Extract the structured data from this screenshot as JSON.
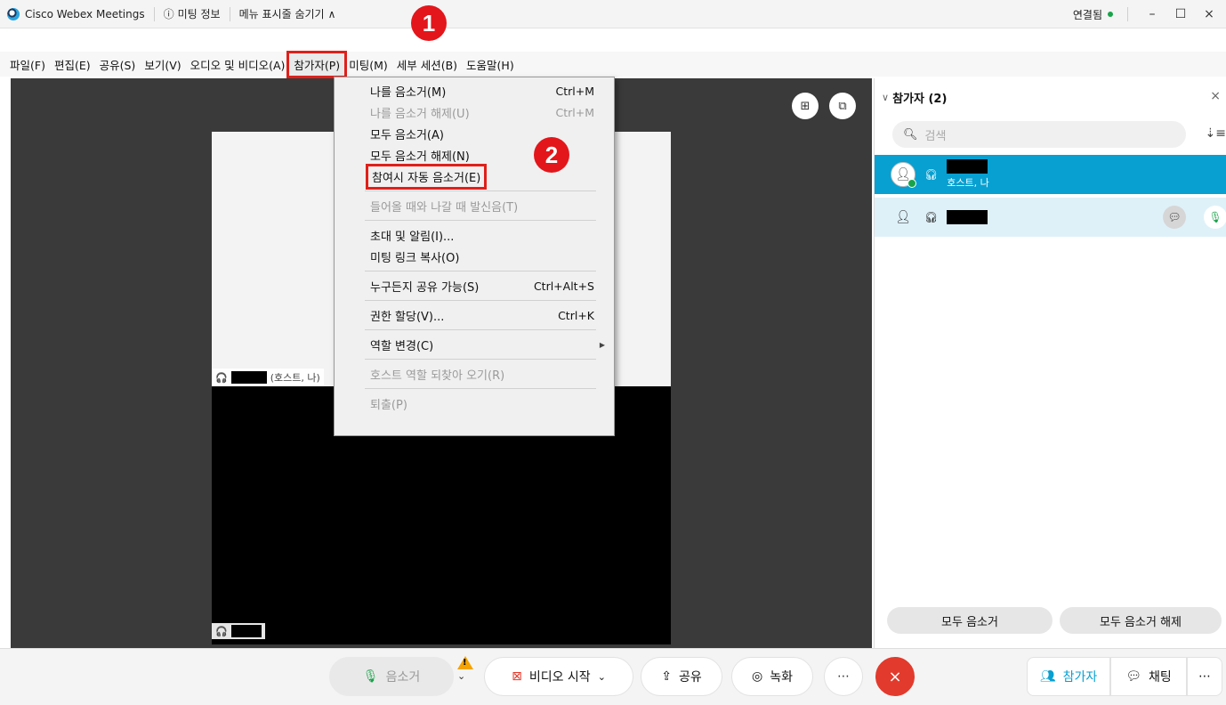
{
  "titlebar": {
    "app_name": "Cisco Webex Meetings",
    "meeting_info": "미팅 정보",
    "hide_menu": "메뉴 표시줄 숨기기",
    "status": "연결됨"
  },
  "menubar": {
    "items": [
      "파일(F)",
      "편집(E)",
      "공유(S)",
      "보기(V)",
      "오디오 및 비디오(A)",
      "참가자(P)",
      "미팅(M)",
      "세부 세션(B)",
      "도움말(H)"
    ]
  },
  "dropdown": {
    "items": [
      {
        "label": "나를 음소거(M)",
        "shortcut": "Ctrl+M"
      },
      {
        "label": "나를 음소거 해제(U)",
        "shortcut": "Ctrl+M"
      },
      {
        "label": "모두 음소거(A)"
      },
      {
        "label": "모두 음소거 해제(N)"
      },
      {
        "label": "참여시 자동 음소거(E)"
      },
      {
        "label": "들어올 때와 나갈 때 발신음(T)"
      },
      {
        "label": "초대 및 알림(I)..."
      },
      {
        "label": "미팅 링크 복사(O)"
      },
      {
        "label": "누구든지 공유 가능(S)",
        "shortcut": "Ctrl+Alt+S"
      },
      {
        "label": "권한 할당(V)...",
        "shortcut": "Ctrl+K"
      },
      {
        "label": "역할 변경(C)"
      },
      {
        "label": "호스트 역할 되찾아 오기(R)"
      },
      {
        "label": "퇴출(P)"
      }
    ]
  },
  "badges": {
    "one": "1",
    "two": "2"
  },
  "stage": {
    "host_tag": "(호스트, 나)"
  },
  "panel": {
    "title": "참가자 (2)",
    "search_placeholder": "검색",
    "host_sub": "호스트, 나",
    "mute_all": "모두 음소거",
    "unmute_all": "모두 음소거 해제"
  },
  "toolbar": {
    "mute": "음소거",
    "video": "비디오 시작",
    "share": "공유",
    "record": "녹화",
    "participants": "참가자",
    "chat": "채팅"
  },
  "colors": {
    "highlight": "#e0201a",
    "selected_row": "#07a0d1",
    "end_call": "#e23a2c"
  }
}
